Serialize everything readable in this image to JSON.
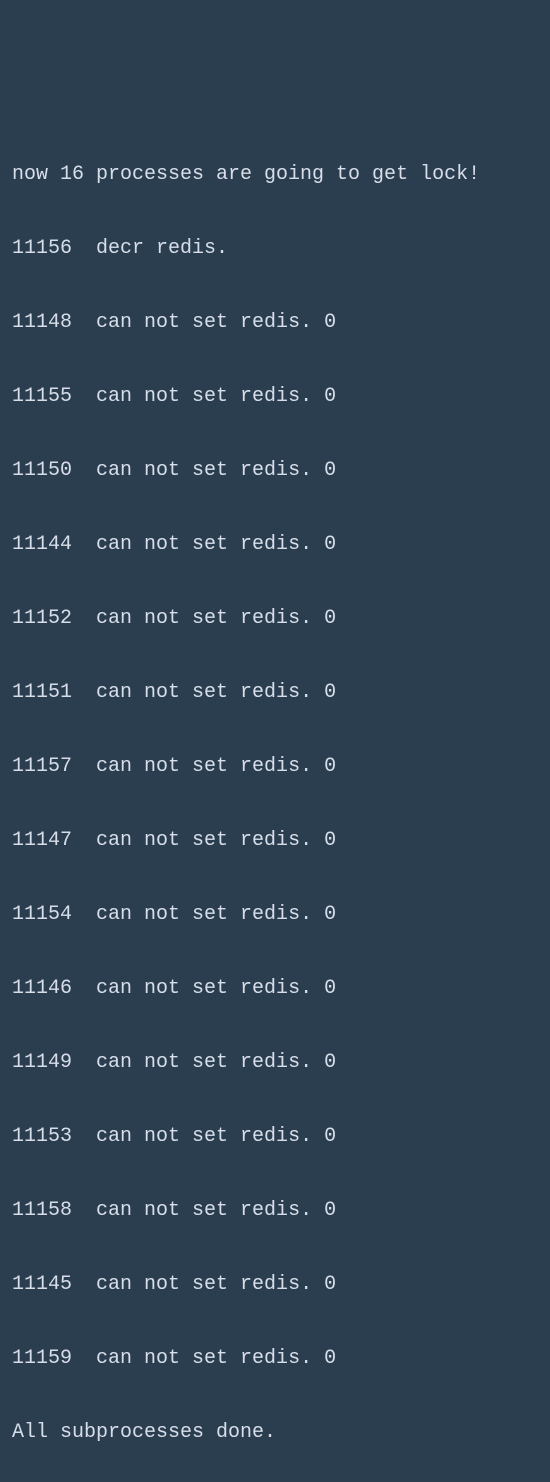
{
  "terminal": {
    "header": "now 16 processes are going to get lock!",
    "lines": [
      {
        "pid": "11156",
        "msg": "decr redis."
      },
      {
        "pid": "11148",
        "msg": "can not set redis. 0"
      },
      {
        "pid": "11155",
        "msg": "can not set redis. 0"
      },
      {
        "pid": "11150",
        "msg": "can not set redis. 0"
      },
      {
        "pid": "11144",
        "msg": "can not set redis. 0"
      },
      {
        "pid": "11152",
        "msg": "can not set redis. 0"
      },
      {
        "pid": "11151",
        "msg": "can not set redis. 0"
      },
      {
        "pid": "11157",
        "msg": "can not set redis. 0"
      },
      {
        "pid": "11147",
        "msg": "can not set redis. 0"
      },
      {
        "pid": "11154",
        "msg": "can not set redis. 0"
      },
      {
        "pid": "11146",
        "msg": "can not set redis. 0"
      },
      {
        "pid": "11149",
        "msg": "can not set redis. 0"
      },
      {
        "pid": "11153",
        "msg": "can not set redis. 0"
      },
      {
        "pid": "11158",
        "msg": "can not set redis. 0"
      },
      {
        "pid": "11145",
        "msg": "can not set redis. 0"
      },
      {
        "pid": "11159",
        "msg": "can not set redis. 0"
      }
    ],
    "footer": "All subprocesses done."
  }
}
